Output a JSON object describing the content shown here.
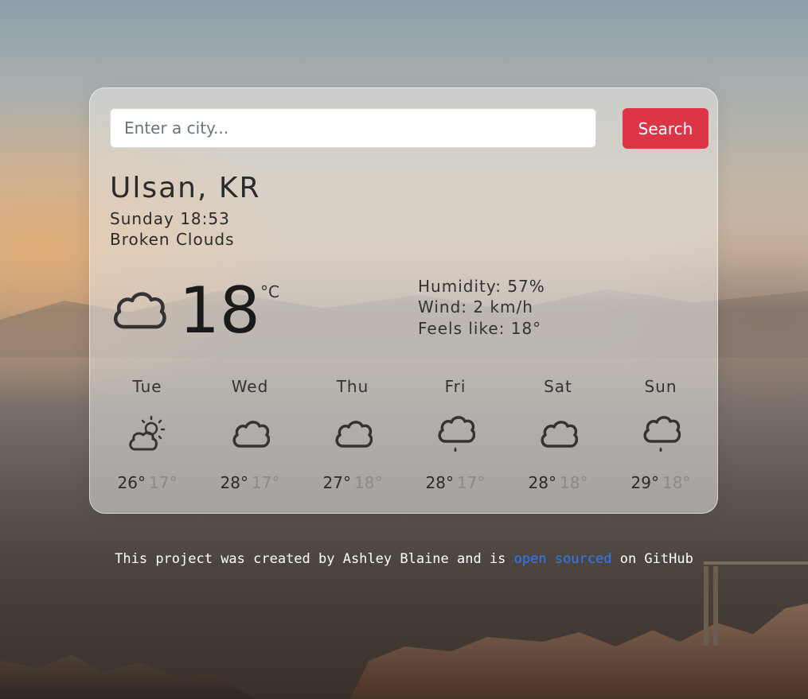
{
  "search": {
    "placeholder": "Enter a city...",
    "value": "",
    "button_label": "Search"
  },
  "current": {
    "city": "Ulsan, KR",
    "datetime": "Sunday 18:53",
    "description": "Broken Clouds",
    "icon": "cloud-icon",
    "temperature": "18",
    "unit": "°C",
    "humidity": "Humidity: 57%",
    "wind": "Wind: 2 km/h",
    "feels_like": "Feels like: 18°"
  },
  "forecast": [
    {
      "day": "Tue",
      "icon": "partly-sunny-icon",
      "high": "26°",
      "low": "17°"
    },
    {
      "day": "Wed",
      "icon": "cloud-icon",
      "high": "28°",
      "low": "17°"
    },
    {
      "day": "Thu",
      "icon": "cloud-icon",
      "high": "27°",
      "low": "18°"
    },
    {
      "day": "Fri",
      "icon": "rain-cloud-icon",
      "high": "28°",
      "low": "17°"
    },
    {
      "day": "Sat",
      "icon": "cloud-icon",
      "high": "28°",
      "low": "18°"
    },
    {
      "day": "Sun",
      "icon": "rain-cloud-icon",
      "high": "29°",
      "low": "18°"
    }
  ],
  "footer": {
    "prefix": "This project was created by Ashley Blaine and is ",
    "link_text": "open sourced",
    "suffix": " on GitHub"
  },
  "colors": {
    "accent_button": "#dc3545",
    "link": "#2b7bff"
  }
}
